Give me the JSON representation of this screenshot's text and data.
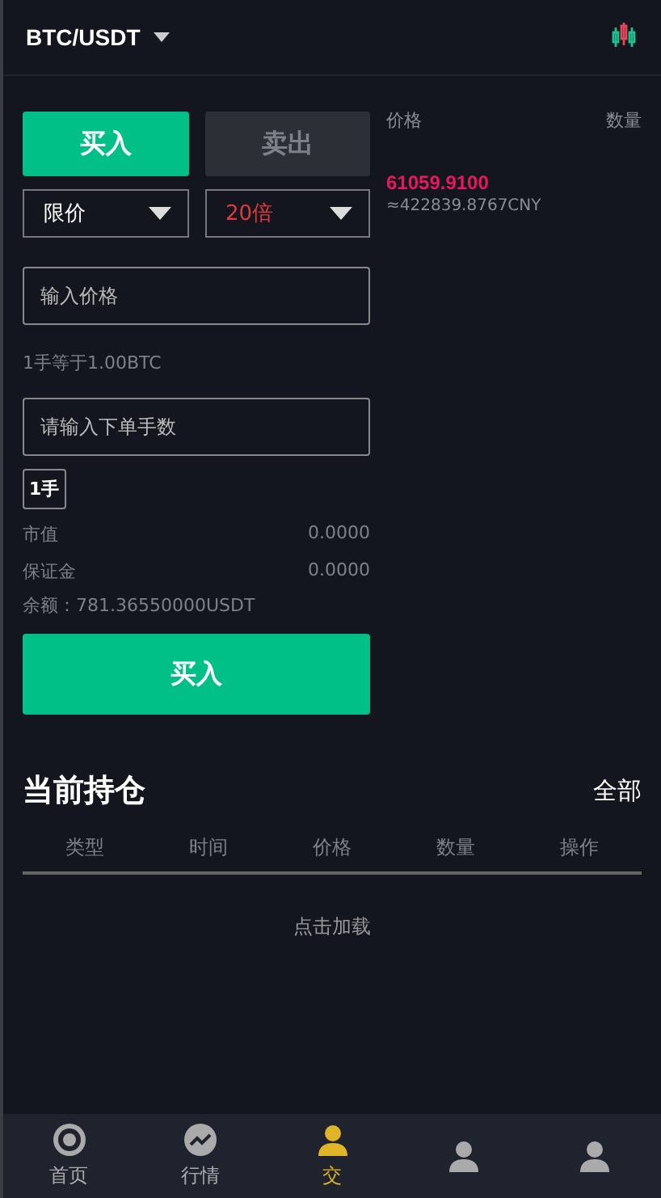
{
  "header": {
    "pair": "BTC/USDT"
  },
  "trade_tabs": [
    {
      "label": "买入",
      "selected": true
    },
    {
      "label": "卖出",
      "selected": false
    }
  ],
  "selects": [
    {
      "value": "限价",
      "kind": "plain"
    },
    {
      "value": "20倍",
      "kind": "leverage"
    }
  ],
  "price_field": {
    "placeholder": "输入价格"
  },
  "lot_note": "1手等于1.00BTC",
  "lots_field": {
    "placeholder": "请输入下单手数"
  },
  "lot_chip": "1手",
  "stats": [
    {
      "label": "市值",
      "value": "0.0000"
    },
    {
      "label": "保证金",
      "value": "0.0000"
    }
  ],
  "balance": "余额：781.36550000USDT",
  "submit": "买入",
  "book": {
    "price_header": "价格",
    "qty_header": "数量",
    "last_price": "61059.9100",
    "cny": "≈422839.8767CNY"
  },
  "positions": {
    "title": "当前持仓",
    "all": "全部",
    "columns": [
      "类型",
      "时间",
      "价格",
      "数量",
      "操作"
    ],
    "load": "点击加载"
  },
  "nav": [
    {
      "label": "首页",
      "kind": "home",
      "selected": false
    },
    {
      "label": "行情",
      "kind": "market",
      "selected": false
    },
    {
      "label": "交",
      "kind": "trade",
      "selected": true
    },
    {
      "kind": "assets",
      "selected": false
    },
    {
      "kind": "mine",
      "selected": false
    }
  ]
}
